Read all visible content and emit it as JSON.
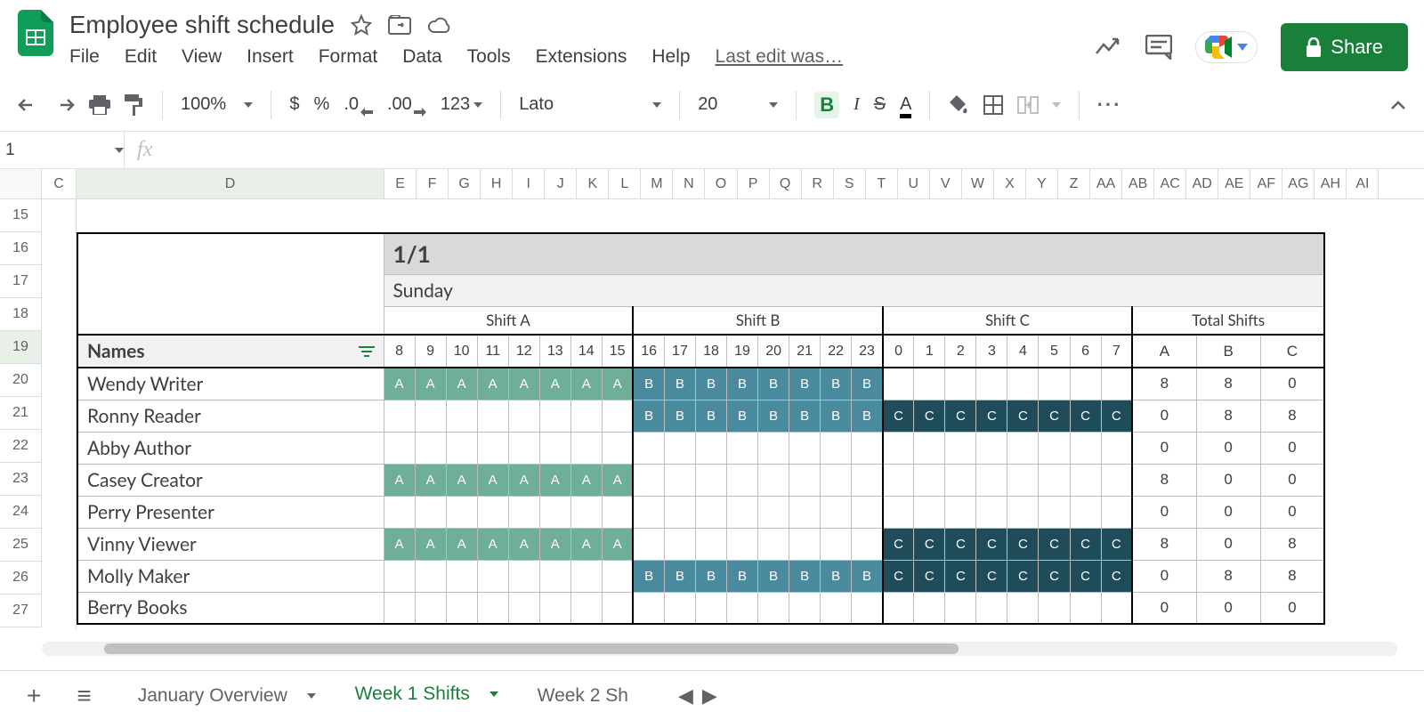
{
  "header": {
    "doc_title": "Employee shift schedule",
    "last_edit": "Last edit was…",
    "share_label": "Share"
  },
  "menubar": [
    "File",
    "Edit",
    "View",
    "Insert",
    "Format",
    "Data",
    "Tools",
    "Extensions",
    "Help"
  ],
  "toolbar": {
    "zoom": "100%",
    "currency": "$",
    "percent": "%",
    "dec_dec": ".0",
    "inc_dec": ".00",
    "numfmt": "123",
    "font": "Lato",
    "font_size": "20",
    "bold": "B",
    "italic": "I",
    "strike": "S",
    "text_color": "A",
    "more": "···"
  },
  "namebox": "1",
  "columns": [
    "C",
    "D",
    "E",
    "F",
    "G",
    "H",
    "I",
    "J",
    "K",
    "L",
    "M",
    "N",
    "O",
    "P",
    "Q",
    "R",
    "S",
    "T",
    "U",
    "V",
    "W",
    "X",
    "Y",
    "Z",
    "AA",
    "AB",
    "AC",
    "AD",
    "AE",
    "AF",
    "AG",
    "AH",
    "AI"
  ],
  "row_numbers": [
    "15",
    "16",
    "17",
    "18",
    "19",
    "20",
    "21",
    "22",
    "23",
    "24",
    "25",
    "26",
    "27"
  ],
  "sheet": {
    "date": "1/1",
    "day": "Sunday",
    "shift_headers": [
      "Shift A",
      "Shift B",
      "Shift C",
      "Total Shifts"
    ],
    "names_label": "Names",
    "hours": [
      "8",
      "9",
      "10",
      "11",
      "12",
      "13",
      "14",
      "15",
      "16",
      "17",
      "18",
      "19",
      "20",
      "21",
      "22",
      "23",
      "0",
      "1",
      "2",
      "3",
      "4",
      "5",
      "6",
      "7"
    ],
    "total_cols": [
      "A",
      "B",
      "C"
    ],
    "employees": [
      {
        "name": "Wendy Writer",
        "shifts": [
          "A",
          "A",
          "A",
          "A",
          "A",
          "A",
          "A",
          "A",
          "B",
          "B",
          "B",
          "B",
          "B",
          "B",
          "B",
          "B",
          "",
          "",
          "",
          "",
          "",
          "",
          "",
          ""
        ],
        "totals": [
          "8",
          "8",
          "0"
        ]
      },
      {
        "name": "Ronny Reader",
        "shifts": [
          "",
          "",
          "",
          "",
          "",
          "",
          "",
          "",
          "B",
          "B",
          "B",
          "B",
          "B",
          "B",
          "B",
          "B",
          "C",
          "C",
          "C",
          "C",
          "C",
          "C",
          "C",
          "C"
        ],
        "totals": [
          "0",
          "8",
          "8"
        ]
      },
      {
        "name": "Abby Author",
        "shifts": [
          "",
          "",
          "",
          "",
          "",
          "",
          "",
          "",
          "",
          "",
          "",
          "",
          "",
          "",
          "",
          "",
          "",
          "",
          "",
          "",
          "",
          "",
          "",
          ""
        ],
        "totals": [
          "0",
          "0",
          "0"
        ]
      },
      {
        "name": "Casey Creator",
        "shifts": [
          "A",
          "A",
          "A",
          "A",
          "A",
          "A",
          "A",
          "A",
          "",
          "",
          "",
          "",
          "",
          "",
          "",
          "",
          "",
          "",
          "",
          "",
          "",
          "",
          "",
          ""
        ],
        "totals": [
          "8",
          "0",
          "0"
        ]
      },
      {
        "name": "Perry Presenter",
        "shifts": [
          "",
          "",
          "",
          "",
          "",
          "",
          "",
          "",
          "",
          "",
          "",
          "",
          "",
          "",
          "",
          "",
          "",
          "",
          "",
          "",
          "",
          "",
          "",
          ""
        ],
        "totals": [
          "0",
          "0",
          "0"
        ]
      },
      {
        "name": "Vinny Viewer",
        "shifts": [
          "A",
          "A",
          "A",
          "A",
          "A",
          "A",
          "A",
          "A",
          "",
          "",
          "",
          "",
          "",
          "",
          "",
          "",
          "C",
          "C",
          "C",
          "C",
          "C",
          "C",
          "C",
          "C"
        ],
        "totals": [
          "8",
          "0",
          "8"
        ]
      },
      {
        "name": "Molly Maker",
        "shifts": [
          "",
          "",
          "",
          "",
          "",
          "",
          "",
          "",
          "B",
          "B",
          "B",
          "B",
          "B",
          "B",
          "B",
          "B",
          "C",
          "C",
          "C",
          "C",
          "C",
          "C",
          "C",
          "C"
        ],
        "totals": [
          "0",
          "8",
          "8"
        ]
      },
      {
        "name": "Berry Books",
        "shifts": [
          "",
          "",
          "",
          "",
          "",
          "",
          "",
          "",
          "",
          "",
          "",
          "",
          "",
          "",
          "",
          "",
          "",
          "",
          "",
          "",
          "",
          "",
          "",
          ""
        ],
        "totals": [
          "0",
          "0",
          "0"
        ]
      }
    ]
  },
  "tabs": {
    "items": [
      "January Overview",
      "Week 1 Shifts",
      "Week 2 Sh"
    ],
    "active_index": 1
  }
}
